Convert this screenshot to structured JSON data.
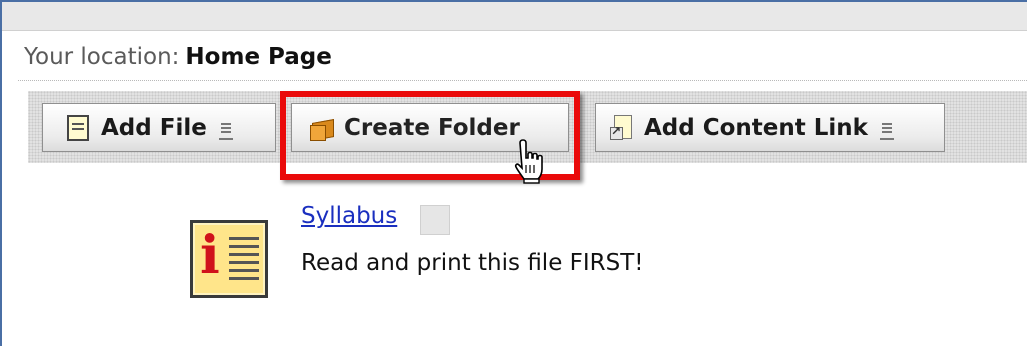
{
  "location": {
    "label": "Your location:",
    "current": "Home Page"
  },
  "toolbar": {
    "buttons": [
      {
        "label": "Add File",
        "icon": "file-icon",
        "has_menu": true
      },
      {
        "label": "Create Folder",
        "icon": "folder-icon",
        "has_menu": false,
        "highlighted": true
      },
      {
        "label": "Add Content Link",
        "icon": "content-link-icon",
        "has_menu": true
      }
    ]
  },
  "content": {
    "items": [
      {
        "title": "Syllabus",
        "description": "Read and print this file FIRST!",
        "icon": "info-document-icon"
      }
    ]
  },
  "colors": {
    "highlight": "#ea0a0a",
    "link": "#1a2fbf",
    "frame": "#4a6fa5"
  }
}
